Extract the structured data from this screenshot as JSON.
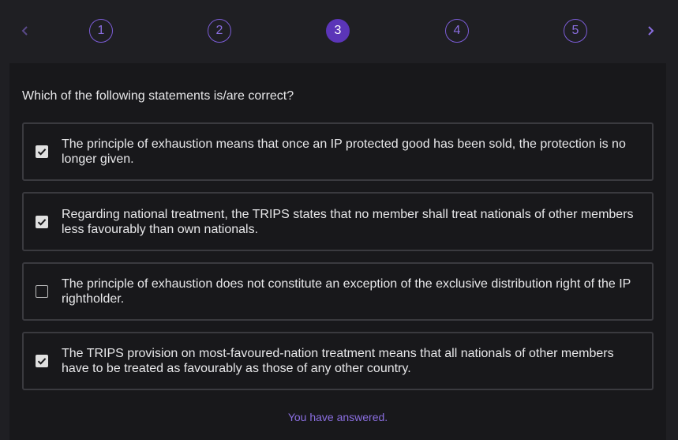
{
  "stepper": {
    "steps": [
      {
        "label": "1",
        "active": false
      },
      {
        "label": "2",
        "active": false
      },
      {
        "label": "3",
        "active": true
      },
      {
        "label": "4",
        "active": false
      },
      {
        "label": "5",
        "active": false
      }
    ],
    "icons": {
      "prev": "chevron-left-icon",
      "next": "chevron-right-icon"
    },
    "accent_color": "#5b35b8"
  },
  "question": {
    "text": "Which of the following statements is/are correct?",
    "options": [
      {
        "text": "The principle of exhaustion means that once an IP protected good has been sold, the protection is no longer given.",
        "checked": true
      },
      {
        "text": "Regarding national treatment, the TRIPS states that no member shall treat nationals of other members less favourably than own nationals.",
        "checked": true
      },
      {
        "text": "The principle of exhaustion does not constitute an exception of the exclusive distribution right of the IP rightholder.",
        "checked": false
      },
      {
        "text": "The TRIPS provision on most-favoured-nation treatment means that all nationals of other members have to be treated as favourably as those of any other country.",
        "checked": true
      }
    ]
  },
  "status": {
    "text": "You have answered."
  }
}
